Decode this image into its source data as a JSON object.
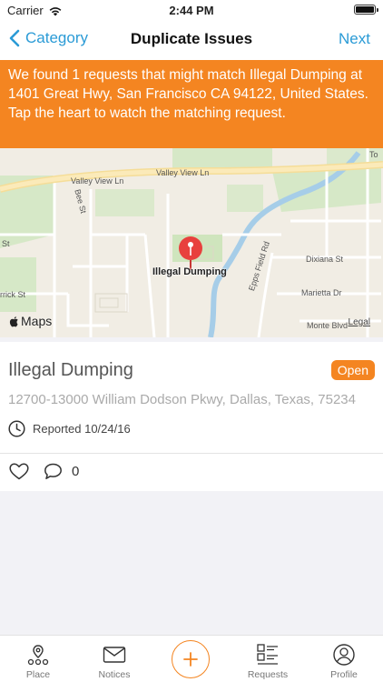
{
  "status_bar": {
    "carrier": "Carrier",
    "time": "2:44 PM"
  },
  "nav": {
    "back_label": "Category",
    "title": "Duplicate Issues",
    "next_label": "Next"
  },
  "banner": {
    "line1": "We found 1 requests that might match Illegal Dumping at 1401 Great Hwy, San Francisco CA 94122, United States.",
    "line2": "Tap the heart to watch the matching request."
  },
  "map": {
    "pin_label": "Illegal Dumping",
    "logo_text": "Maps",
    "legal_text": "Legal",
    "street_labels": {
      "valley_view_top": "Valley View Ln",
      "valley_view_left": "Valley View Ln",
      "bee": "Bee St",
      "dixiana": "Dixiana St",
      "marietta": "Marietta Dr",
      "epps": "Epps Field Rd",
      "monte": "Monte Blvd",
      "rick": "rrick St",
      "st": "St",
      "to": "To"
    }
  },
  "issue": {
    "title": "Illegal Dumping",
    "status": "Open",
    "address": "12700-13000 William Dodson Pkwy, Dallas, Texas, 75234",
    "reported": "Reported 10/24/16",
    "comment_count": "0"
  },
  "tabs": [
    {
      "label": "Place",
      "icon": "place-icon"
    },
    {
      "label": "Notices",
      "icon": "mail-icon"
    },
    {
      "label": "",
      "icon": "plus-icon"
    },
    {
      "label": "Requests",
      "icon": "list-icon"
    },
    {
      "label": "Profile",
      "icon": "profile-icon"
    }
  ],
  "colors": {
    "accent": "#f48521",
    "link": "#2b9bd6",
    "pin": "#e8403d"
  }
}
